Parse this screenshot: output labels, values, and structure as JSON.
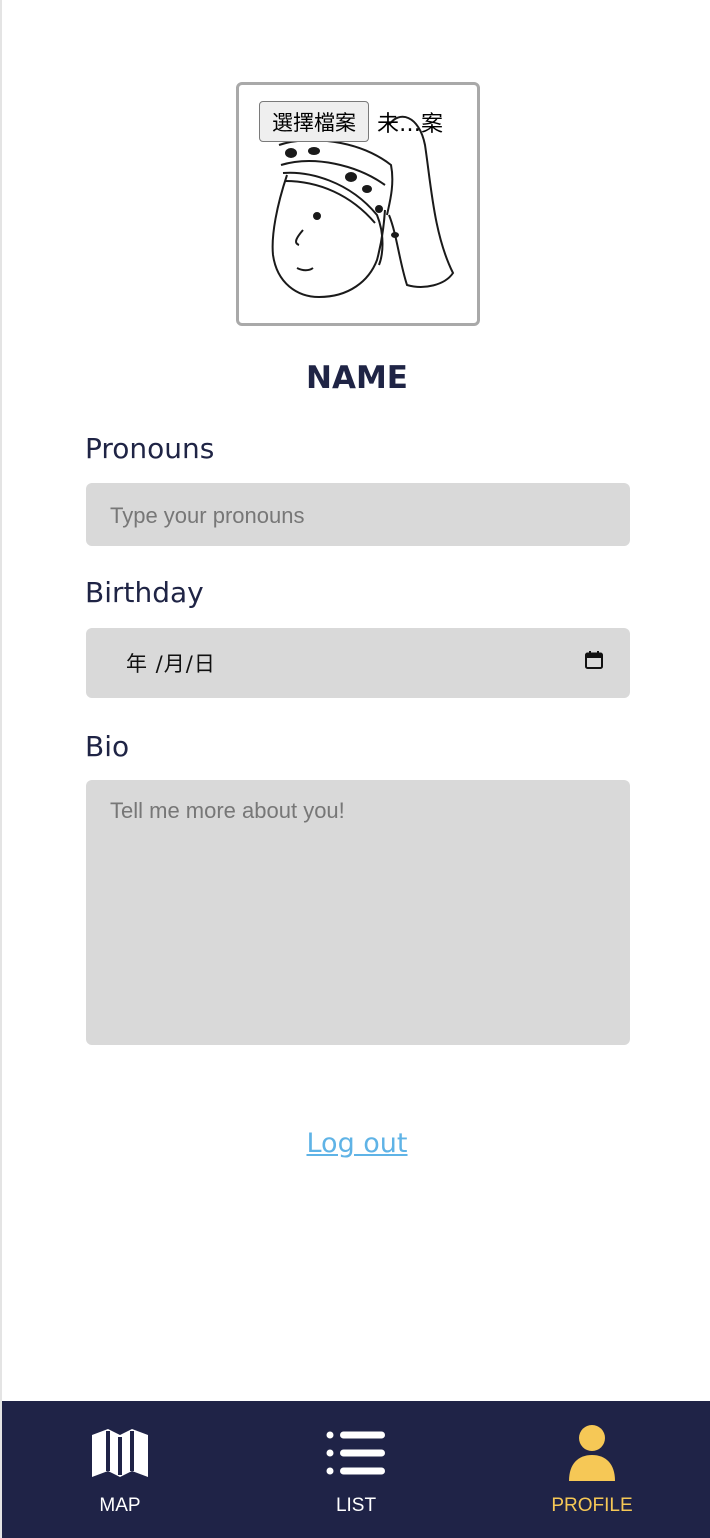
{
  "profile": {
    "photo_upload": {
      "button_label": "選擇檔案",
      "file_status": "未…案"
    },
    "name": "NAME",
    "pronouns": {
      "label": "Pronouns",
      "placeholder": "Type your pronouns"
    },
    "birthday": {
      "label": "Birthday",
      "date_placeholder": "年 /月/日"
    },
    "bio": {
      "label": "Bio",
      "placeholder": "Tell me more about you!"
    },
    "logout_label": "Log out"
  },
  "tabbar": {
    "tabs": [
      {
        "label": "MAP",
        "icon": "map-icon",
        "active": false
      },
      {
        "label": "LIST",
        "icon": "list-icon",
        "active": false
      },
      {
        "label": "PROFILE",
        "icon": "person-icon",
        "active": true
      }
    ]
  },
  "colors": {
    "navy": "#1f2347",
    "accent_yellow": "#f6c856",
    "link_blue": "#5fb3e6",
    "field_gray": "#d9d9d9"
  }
}
